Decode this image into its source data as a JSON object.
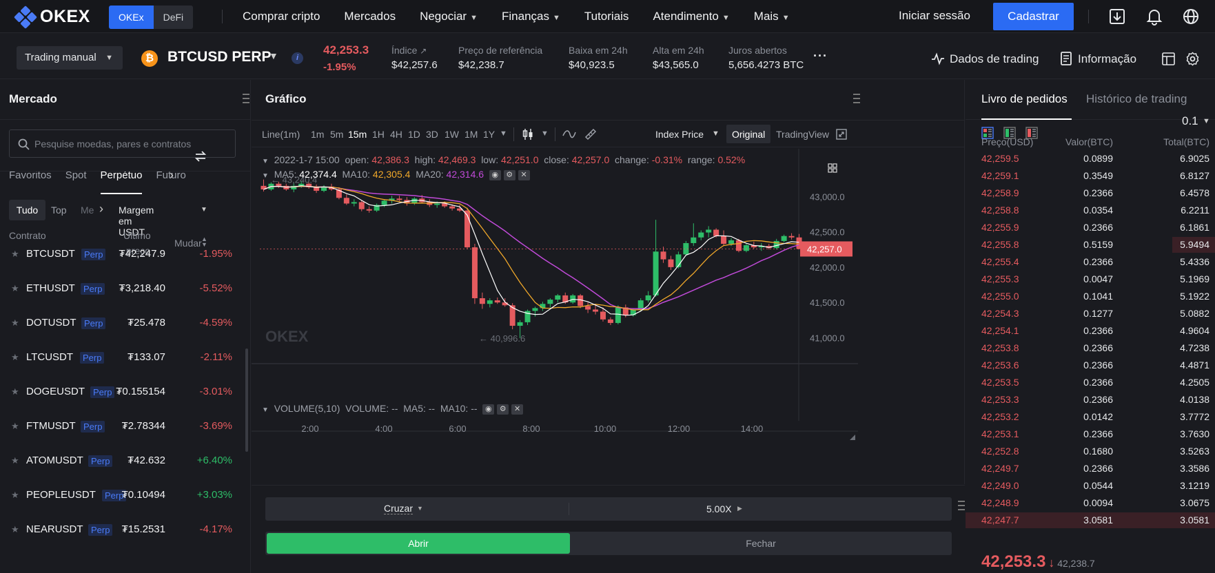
{
  "nav": {
    "logo_text": "OKEX",
    "seg_okex": "OKEx",
    "seg_defi": "DeFi",
    "links": [
      "Comprar cripto",
      "Mercados",
      "Negociar",
      "Finanças",
      "Tutoriais",
      "Atendimento",
      "Mais"
    ],
    "login": "Iniciar sessão",
    "signup": "Cadastrar"
  },
  "ticker": {
    "mode": "Trading manual",
    "coin_glyph": "₿",
    "pair": "BTCUSD PERP",
    "last_price": "42,253.3",
    "change_pct": "-1.95%",
    "stats": [
      {
        "label": "Índice",
        "value": "$42,257.6"
      },
      {
        "label": "Preço de referência",
        "value": "$42,238.7"
      },
      {
        "label": "Baixa em 24h",
        "value": "$40,923.5"
      },
      {
        "label": "Alta em 24h",
        "value": "$43,565.0"
      },
      {
        "label": "Juros abertos",
        "value": "5,656.4273 BTC"
      }
    ],
    "trading_data": "Dados de trading",
    "info": "Informação"
  },
  "market": {
    "title": "Mercado",
    "search_placeholder": "Pesquise moedas, pares e contratos",
    "tabs": [
      "Favoritos",
      "Spot",
      "Perpétuo",
      "Futuro"
    ],
    "subtabs": [
      "Tudo",
      "Top",
      "Me"
    ],
    "margin": "Margem em USDT",
    "col_contract": "Contrato",
    "col_last_1": "Último",
    "col_last_2": "preço",
    "col_change": "Mudar",
    "perp_tag": "Perp",
    "rows": [
      {
        "sym": "BTCUSDT",
        "price": "₮42,247.9",
        "chg": "-1.95%",
        "dir": "neg"
      },
      {
        "sym": "ETHUSDT",
        "price": "₮3,218.40",
        "chg": "-5.52%",
        "dir": "neg"
      },
      {
        "sym": "DOTUSDT",
        "price": "₮25.478",
        "chg": "-4.59%",
        "dir": "neg"
      },
      {
        "sym": "LTCUSDT",
        "price": "₮133.07",
        "chg": "-2.11%",
        "dir": "neg"
      },
      {
        "sym": "DOGEUSDT",
        "price": "₮0.155154",
        "chg": "-3.01%",
        "dir": "neg"
      },
      {
        "sym": "FTMUSDT",
        "price": "₮2.78344",
        "chg": "-3.69%",
        "dir": "neg"
      },
      {
        "sym": "ATOMUSDT",
        "price": "₮42.632",
        "chg": "+6.40%",
        "dir": "pos"
      },
      {
        "sym": "PEOPLEUSDT",
        "price": "₮0.10494",
        "chg": "+3.03%",
        "dir": "pos"
      },
      {
        "sym": "NEARUSDT",
        "price": "₮15.2531",
        "chg": "-4.17%",
        "dir": "neg"
      }
    ]
  },
  "chart": {
    "title": "Gráfico",
    "timeframes": [
      "Line(1m)",
      "1m",
      "5m",
      "15m",
      "1H",
      "4H",
      "1D",
      "3D",
      "1W",
      "1M",
      "1Y"
    ],
    "active_tf": "15m",
    "index_price": "Index Price",
    "original": "Original",
    "tradingview": "TradingView",
    "ohlc": {
      "date": "2022-1-7 15:00",
      "open_l": "open:",
      "open": "42,386.3",
      "high_l": "high:",
      "high": "42,469.3",
      "low_l": "low:",
      "low": "42,251.0",
      "close_l": "close:",
      "close": "42,257.0",
      "change_l": "change:",
      "change": "-0.31%",
      "range_l": "range:",
      "range": "0.52%"
    },
    "ma": {
      "ma5_l": "MA5:",
      "ma5": "42,374.4",
      "ma10_l": "MA10:",
      "ma10": "42,305.4",
      "ma20_l": "MA20:",
      "ma20": "42,314.6"
    },
    "volume": "VOLUME(5,10)",
    "volume_l": "VOLUME: --",
    "vol_ma5": "MA5: --",
    "vol_ma10": "MA10: --",
    "watermark": "OKEX",
    "high_marker": "43,240.4",
    "low_marker": "40,996.6",
    "current_tag": "42,257.0"
  },
  "chart_data": {
    "type": "candlestick",
    "y_ticks": [
      "43,000.0",
      "42,500.0",
      "42,000.0",
      "41,500.0",
      "41,000.0"
    ],
    "y_tick_values": [
      43000,
      42500,
      42000,
      41500,
      41000
    ],
    "x_ticks": [
      "2:00",
      "4:00",
      "6:00",
      "8:00",
      "10:00",
      "12:00",
      "14:00"
    ],
    "ylim": [
      40800,
      43480
    ],
    "candles": [
      [
        43150,
        43240,
        43070,
        43100
      ],
      [
        43100,
        43200,
        43080,
        43180
      ],
      [
        43180,
        43210,
        43120,
        43150
      ],
      [
        43150,
        43180,
        43080,
        43100
      ],
      [
        43100,
        43190,
        43060,
        43150
      ],
      [
        43150,
        43220,
        43120,
        43180
      ],
      [
        43180,
        43200,
        43110,
        43130
      ],
      [
        43130,
        43170,
        43050,
        43080
      ],
      [
        43080,
        43160,
        43060,
        43140
      ],
      [
        43140,
        43180,
        43080,
        43100
      ],
      [
        43100,
        43130,
        42960,
        42980
      ],
      [
        42980,
        43030,
        42880,
        42900
      ],
      [
        42900,
        42960,
        42860,
        42920
      ],
      [
        42920,
        42950,
        42790,
        42820
      ],
      [
        42820,
        42860,
        42770,
        42800
      ],
      [
        42800,
        42900,
        42780,
        42880
      ],
      [
        42880,
        42960,
        42850,
        42940
      ],
      [
        42940,
        43010,
        42900,
        42970
      ],
      [
        42970,
        43010,
        42920,
        42950
      ],
      [
        42950,
        42990,
        42870,
        42900
      ],
      [
        42900,
        42990,
        42880,
        42970
      ],
      [
        42970,
        43020,
        42900,
        42920
      ],
      [
        42920,
        42960,
        42850,
        42880
      ],
      [
        42880,
        42930,
        42840,
        42900
      ],
      [
        42900,
        42930,
        42840,
        42860
      ],
      [
        42860,
        42890,
        42800,
        42830
      ],
      [
        42830,
        42880,
        42780,
        42800
      ],
      [
        42800,
        42840,
        42260,
        42280
      ],
      [
        42280,
        42330,
        41480,
        41560
      ],
      [
        41560,
        41640,
        41410,
        41480
      ],
      [
        41480,
        41560,
        41430,
        41530
      ],
      [
        41530,
        41570,
        41480,
        41500
      ],
      [
        41500,
        41560,
        41440,
        41460
      ],
      [
        41460,
        41490,
        41120,
        41170
      ],
      [
        41170,
        41250,
        40996,
        41220
      ],
      [
        41220,
        41400,
        41180,
        41380
      ],
      [
        41380,
        41440,
        41300,
        41420
      ],
      [
        41420,
        41510,
        41380,
        41480
      ],
      [
        41480,
        41560,
        41430,
        41540
      ],
      [
        41540,
        41620,
        41500,
        41600
      ],
      [
        41600,
        41640,
        41480,
        41500
      ],
      [
        41500,
        41620,
        41480,
        41600
      ],
      [
        41600,
        41620,
        41420,
        41450
      ],
      [
        41450,
        41500,
        41350,
        41400
      ],
      [
        41400,
        41460,
        41330,
        41370
      ],
      [
        41370,
        41430,
        41230,
        41260
      ],
      [
        41260,
        41290,
        41180,
        41210
      ],
      [
        41210,
        41460,
        41190,
        41430
      ],
      [
        41430,
        41470,
        41290,
        41320
      ],
      [
        41320,
        41420,
        41300,
        41400
      ],
      [
        41400,
        41560,
        41380,
        41530
      ],
      [
        41530,
        41660,
        41500,
        41600
      ],
      [
        41600,
        42670,
        41580,
        42220
      ],
      [
        42220,
        42290,
        42060,
        42110
      ],
      [
        42110,
        42160,
        41960,
        42000
      ],
      [
        42000,
        42220,
        41980,
        42180
      ],
      [
        42180,
        42370,
        42160,
        42340
      ],
      [
        42340,
        42620,
        42300,
        42420
      ],
      [
        42420,
        42520,
        42380,
        42490
      ],
      [
        42490,
        42580,
        42420,
        42530
      ],
      [
        42530,
        42550,
        42420,
        42440
      ],
      [
        42440,
        42520,
        42300,
        42330
      ],
      [
        42330,
        42410,
        42300,
        42380
      ],
      [
        42380,
        42400,
        42210,
        42230
      ],
      [
        42230,
        42330,
        42210,
        42310
      ],
      [
        42310,
        42360,
        42260,
        42280
      ],
      [
        42280,
        42340,
        42230,
        42300
      ],
      [
        42300,
        42330,
        42250,
        42270
      ],
      [
        42270,
        42400,
        42250,
        42370
      ],
      [
        42370,
        42460,
        42350,
        42440
      ],
      [
        42440,
        42480,
        42390,
        42420
      ],
      [
        42420,
        42469,
        42251,
        42257
      ]
    ]
  },
  "order_form": {
    "mode": "Cruzar",
    "leverage": "5.00X",
    "open": "Abrir",
    "close": "Fechar"
  },
  "book": {
    "tab_orders": "Livro de pedidos",
    "tab_history": "Histórico de trading",
    "step": "0.1",
    "col_price": "Preço(USD)",
    "col_amount": "Valor(BTC)",
    "col_total": "Total(BTC)",
    "rows": [
      {
        "p": "42,259.5",
        "a": "0.0899",
        "t": "6.9025",
        "w": 0
      },
      {
        "p": "42,259.1",
        "a": "0.3549",
        "t": "6.8127",
        "w": 0
      },
      {
        "p": "42,258.9",
        "a": "0.2366",
        "t": "6.4578",
        "w": 0
      },
      {
        "p": "42,258.8",
        "a": "0.0354",
        "t": "6.2211",
        "w": 0
      },
      {
        "p": "42,255.9",
        "a": "0.2366",
        "t": "6.1861",
        "w": 0
      },
      {
        "p": "42,255.8",
        "a": "0.5159",
        "t": "5.9494",
        "w": 0.17
      },
      {
        "p": "42,255.4",
        "a": "0.2366",
        "t": "5.4336",
        "w": 0
      },
      {
        "p": "42,255.3",
        "a": "0.0047",
        "t": "5.1969",
        "w": 0
      },
      {
        "p": "42,255.0",
        "a": "0.1041",
        "t": "5.1922",
        "w": 0
      },
      {
        "p": "42,254.3",
        "a": "0.1277",
        "t": "5.0882",
        "w": 0
      },
      {
        "p": "42,254.1",
        "a": "0.2366",
        "t": "4.9604",
        "w": 0
      },
      {
        "p": "42,253.8",
        "a": "0.2366",
        "t": "4.7238",
        "w": 0
      },
      {
        "p": "42,253.6",
        "a": "0.2366",
        "t": "4.4871",
        "w": 0
      },
      {
        "p": "42,253.5",
        "a": "0.2366",
        "t": "4.2505",
        "w": 0
      },
      {
        "p": "42,253.3",
        "a": "0.2366",
        "t": "4.0138",
        "w": 0
      },
      {
        "p": "42,253.2",
        "a": "0.0142",
        "t": "3.7772",
        "w": 0
      },
      {
        "p": "42,253.1",
        "a": "0.2366",
        "t": "3.7630",
        "w": 0
      },
      {
        "p": "42,252.8",
        "a": "0.1680",
        "t": "3.5263",
        "w": 0
      },
      {
        "p": "42,249.7",
        "a": "0.2366",
        "t": "3.3586",
        "w": 0
      },
      {
        "p": "42,249.0",
        "a": "0.0544",
        "t": "3.1219",
        "w": 0
      },
      {
        "p": "42,248.9",
        "a": "0.0094",
        "t": "3.0675",
        "w": 0
      },
      {
        "p": "42,247.7",
        "a": "3.0581",
        "t": "3.0581",
        "w": 1
      }
    ],
    "last_price": "42,253.3",
    "mark_price": "42,238.7"
  },
  "colors": {
    "up": "#2ebd68",
    "down": "#e55b5f",
    "accent": "#2b6bf3",
    "ma5": "#ffffff",
    "ma10": "#f0a82a",
    "ma20": "#c04ad8"
  }
}
